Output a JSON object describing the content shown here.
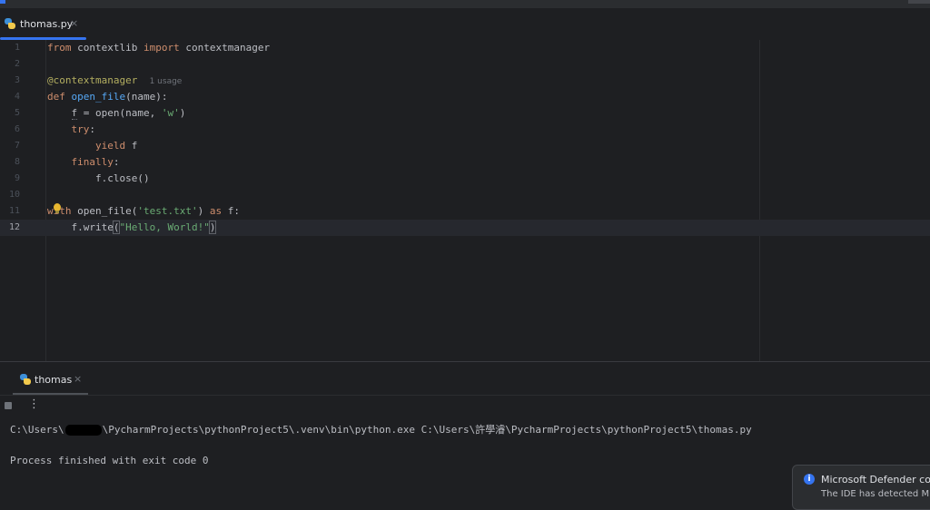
{
  "editor_tab": {
    "label": "thomas.py",
    "close": "×"
  },
  "code": {
    "line_numbers": [
      "1",
      "2",
      "3",
      "4",
      "5",
      "6",
      "7",
      "8",
      "9",
      "10",
      "11",
      "12"
    ],
    "l1": {
      "from": "from",
      "mod": " contextlib ",
      "import": "import",
      "name": " contextmanager"
    },
    "l3": {
      "decorator": "@contextmanager",
      "hint": "1 usage"
    },
    "l4": {
      "def": "def",
      "name": "open_file",
      "rest": "(name):"
    },
    "l5": {
      "a": "f",
      "b": " = ",
      "c": "open",
      "d": "(name, ",
      "e": "'w'",
      "f": ")"
    },
    "l6": {
      "try": "try",
      "colon": ":"
    },
    "l7": {
      "yield": "yield",
      "rest": " f"
    },
    "l8": {
      "finally": "finally",
      "colon": ":"
    },
    "l9": {
      "text": "f.close()"
    },
    "l11": {
      "with": "with",
      "a": " open_file(",
      "b": "'test.txt'",
      "c": ") ",
      "as": "as",
      "d": " f:"
    },
    "l12": {
      "a": "f.write",
      "b": "(",
      "c": "\"Hello, World!\"",
      "d": ")"
    }
  },
  "run_panel": {
    "tab_label": "thomas",
    "close": "×",
    "kebab": "⋮",
    "cmd_prefix": "C:\\Users\\",
    "cmd_rest": "\\PycharmProjects\\pythonProject5\\.venv\\bin\\python.exe C:\\Users\\許學濬\\PycharmProjects\\pythonProject5\\thomas.py",
    "exit_msg": "Process finished with exit code 0"
  },
  "notification": {
    "icon": "i",
    "title": "Microsoft Defender confi",
    "body": "The IDE has detected Micro"
  },
  "colors": {
    "accent": "#3574f0",
    "keyword": "#cf8e6d",
    "function": "#56a8f5",
    "string": "#6aab73",
    "decorator": "#b3ae60"
  }
}
